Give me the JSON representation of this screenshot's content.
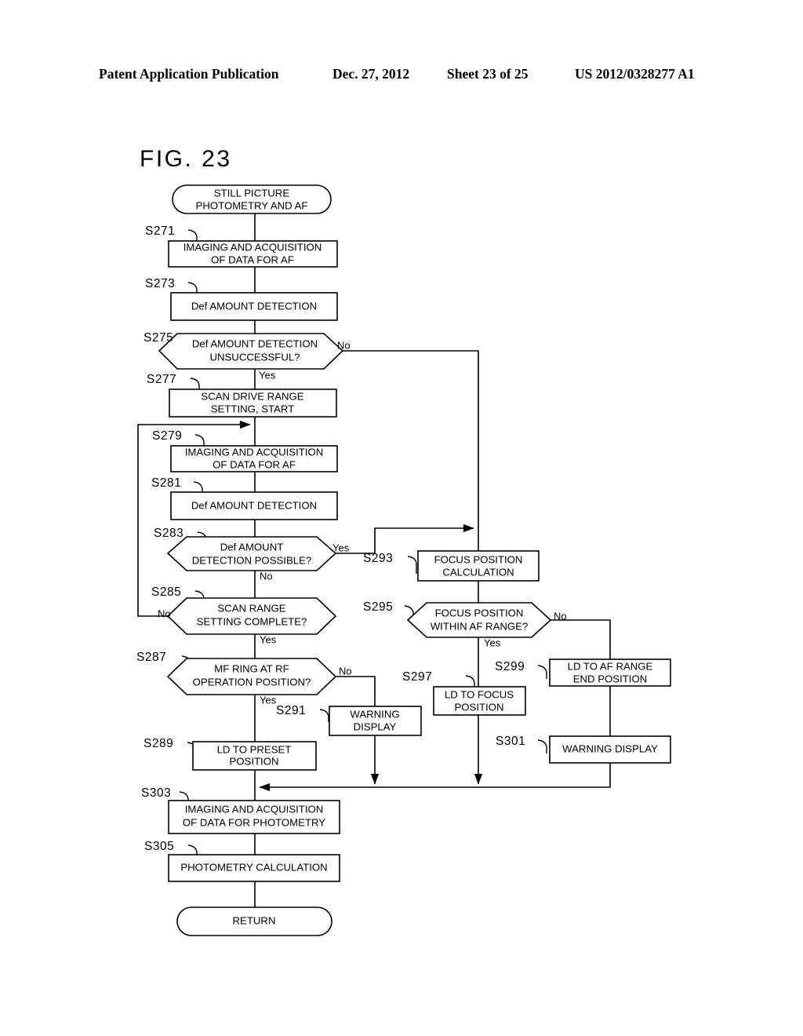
{
  "header": {
    "publication": "Patent Application Publication",
    "date": "Dec. 27, 2012",
    "sheet": "Sheet 23 of 25",
    "number": "US 2012/0328277 A1"
  },
  "figure": {
    "label": "FIG. 23"
  },
  "chart_data": {
    "type": "diagram",
    "title": "FIG. 23",
    "diagram_kind": "flowchart",
    "nodes": [
      {
        "id": "start",
        "shape": "terminator",
        "step": "",
        "text": "STILL PICTURE\nPHOTOMETRY AND AF"
      },
      {
        "id": "s271",
        "shape": "process",
        "step": "S271",
        "text": "IMAGING AND ACQUISITION\nOF DATA FOR AF"
      },
      {
        "id": "s273",
        "shape": "process",
        "step": "S273",
        "text": "Def AMOUNT DETECTION"
      },
      {
        "id": "s275",
        "shape": "decision",
        "step": "S275",
        "text": "Def AMOUNT DETECTION\nUNSUCCESSFUL?"
      },
      {
        "id": "s277",
        "shape": "process",
        "step": "S277",
        "text": "SCAN DRIVE RANGE\nSETTING, START"
      },
      {
        "id": "s279",
        "shape": "process",
        "step": "S279",
        "text": "IMAGING AND ACQUISITION\nOF DATA FOR AF"
      },
      {
        "id": "s281",
        "shape": "process",
        "step": "S281",
        "text": "Def AMOUNT DETECTION"
      },
      {
        "id": "s283",
        "shape": "decision",
        "step": "S283",
        "text": "Def AMOUNT\nDETECTION POSSIBLE?"
      },
      {
        "id": "s285",
        "shape": "decision",
        "step": "S285",
        "text": "SCAN RANGE\nSETTING COMPLETE?"
      },
      {
        "id": "s287",
        "shape": "decision",
        "step": "S287",
        "text": "MF RING AT RF\nOPERATION POSITION?"
      },
      {
        "id": "s289",
        "shape": "process",
        "step": "S289",
        "text": "LD TO PRESET\nPOSITION"
      },
      {
        "id": "s291",
        "shape": "process",
        "step": "S291",
        "text": "WARNING\nDISPLAY"
      },
      {
        "id": "s293",
        "shape": "process",
        "step": "S293",
        "text": "FOCUS POSITION\nCALCULATION"
      },
      {
        "id": "s295",
        "shape": "decision",
        "step": "S295",
        "text": "FOCUS POSITION\nWITHIN AF RANGE?"
      },
      {
        "id": "s297",
        "shape": "process",
        "step": "S297",
        "text": "LD TO FOCUS\nPOSITION"
      },
      {
        "id": "s299",
        "shape": "process",
        "step": "S299",
        "text": "LD TO AF RANGE\nEND POSITION"
      },
      {
        "id": "s301",
        "shape": "process",
        "step": "S301",
        "text": "WARNING DISPLAY"
      },
      {
        "id": "s303",
        "shape": "process",
        "step": "S303",
        "text": "IMAGING AND ACQUISITION\nOF DATA FOR PHOTOMETRY"
      },
      {
        "id": "s305",
        "shape": "process",
        "step": "S305",
        "text": "PHOTOMETRY CALCULATION"
      },
      {
        "id": "return",
        "shape": "terminator",
        "step": "",
        "text": "RETURN"
      }
    ],
    "edges": [
      {
        "from": "start",
        "to": "s271",
        "label": ""
      },
      {
        "from": "s271",
        "to": "s273",
        "label": ""
      },
      {
        "from": "s273",
        "to": "s275",
        "label": ""
      },
      {
        "from": "s275",
        "to": "s277",
        "label": "Yes"
      },
      {
        "from": "s275",
        "to": "s293",
        "label": "No"
      },
      {
        "from": "s277",
        "to": "s279",
        "label": ""
      },
      {
        "from": "s279",
        "to": "s281",
        "label": ""
      },
      {
        "from": "s281",
        "to": "s283",
        "label": ""
      },
      {
        "from": "s283",
        "to": "s293",
        "label": "Yes"
      },
      {
        "from": "s283",
        "to": "s285",
        "label": "No"
      },
      {
        "from": "s285",
        "to": "s279",
        "label": "No"
      },
      {
        "from": "s285",
        "to": "s287",
        "label": "Yes"
      },
      {
        "from": "s287",
        "to": "s289",
        "label": "Yes"
      },
      {
        "from": "s287",
        "to": "s291",
        "label": "No"
      },
      {
        "from": "s289",
        "to": "s303",
        "label": ""
      },
      {
        "from": "s291",
        "to": "s303",
        "label": ""
      },
      {
        "from": "s293",
        "to": "s295",
        "label": ""
      },
      {
        "from": "s295",
        "to": "s297",
        "label": "Yes"
      },
      {
        "from": "s295",
        "to": "s299",
        "label": "No"
      },
      {
        "from": "s297",
        "to": "s303",
        "label": ""
      },
      {
        "from": "s299",
        "to": "s301",
        "label": ""
      },
      {
        "from": "s301",
        "to": "s303",
        "label": ""
      },
      {
        "from": "s303",
        "to": "s305",
        "label": ""
      },
      {
        "from": "s305",
        "to": "return",
        "label": ""
      }
    ]
  },
  "nodes": {
    "start": {
      "line1": "STILL PICTURE",
      "line2": "PHOTOMETRY AND AF"
    },
    "s271": {
      "step": "S271",
      "line1": "IMAGING AND ACQUISITION",
      "line2": "OF DATA FOR AF"
    },
    "s273": {
      "step": "S273",
      "line1": "Def AMOUNT DETECTION",
      "line2": ""
    },
    "s275": {
      "step": "S275",
      "line1": "Def AMOUNT DETECTION",
      "line2": "UNSUCCESSFUL?",
      "yes": "Yes",
      "no": "No"
    },
    "s277": {
      "step": "S277",
      "line1": "SCAN DRIVE RANGE",
      "line2": "SETTING, START"
    },
    "s279": {
      "step": "S279",
      "line1": "IMAGING AND ACQUISITION",
      "line2": "OF DATA FOR AF"
    },
    "s281": {
      "step": "S281",
      "line1": "Def AMOUNT DETECTION",
      "line2": ""
    },
    "s283": {
      "step": "S283",
      "line1": "Def AMOUNT",
      "line2": "DETECTION POSSIBLE?",
      "yes": "Yes",
      "no": "No"
    },
    "s285": {
      "step": "S285",
      "line1": "SCAN RANGE",
      "line2": "SETTING COMPLETE?",
      "yes": "Yes",
      "no": "No"
    },
    "s287": {
      "step": "S287",
      "line1": "MF RING AT RF",
      "line2": "OPERATION POSITION?",
      "yes": "Yes",
      "no": "No"
    },
    "s289": {
      "step": "S289",
      "line1": "LD TO PRESET",
      "line2": "POSITION"
    },
    "s291": {
      "step": "S291",
      "line1": "WARNING",
      "line2": "DISPLAY"
    },
    "s293": {
      "step": "S293",
      "line1": "FOCUS POSITION",
      "line2": "CALCULATION"
    },
    "s295": {
      "step": "S295",
      "line1": "FOCUS POSITION",
      "line2": "WITHIN AF RANGE?",
      "yes": "Yes",
      "no": "No"
    },
    "s297": {
      "step": "S297",
      "line1": "LD TO FOCUS",
      "line2": "POSITION"
    },
    "s299": {
      "step": "S299",
      "line1": "LD TO AF RANGE",
      "line2": "END POSITION"
    },
    "s301": {
      "step": "S301",
      "line1": "WARNING DISPLAY",
      "line2": ""
    },
    "s303": {
      "step": "S303",
      "line1": "IMAGING AND ACQUISITION",
      "line2": "OF DATA FOR PHOTOMETRY"
    },
    "s305": {
      "step": "S305",
      "line1": "PHOTOMETRY CALCULATION",
      "line2": ""
    },
    "return": {
      "line1": "RETURN",
      "line2": ""
    }
  }
}
